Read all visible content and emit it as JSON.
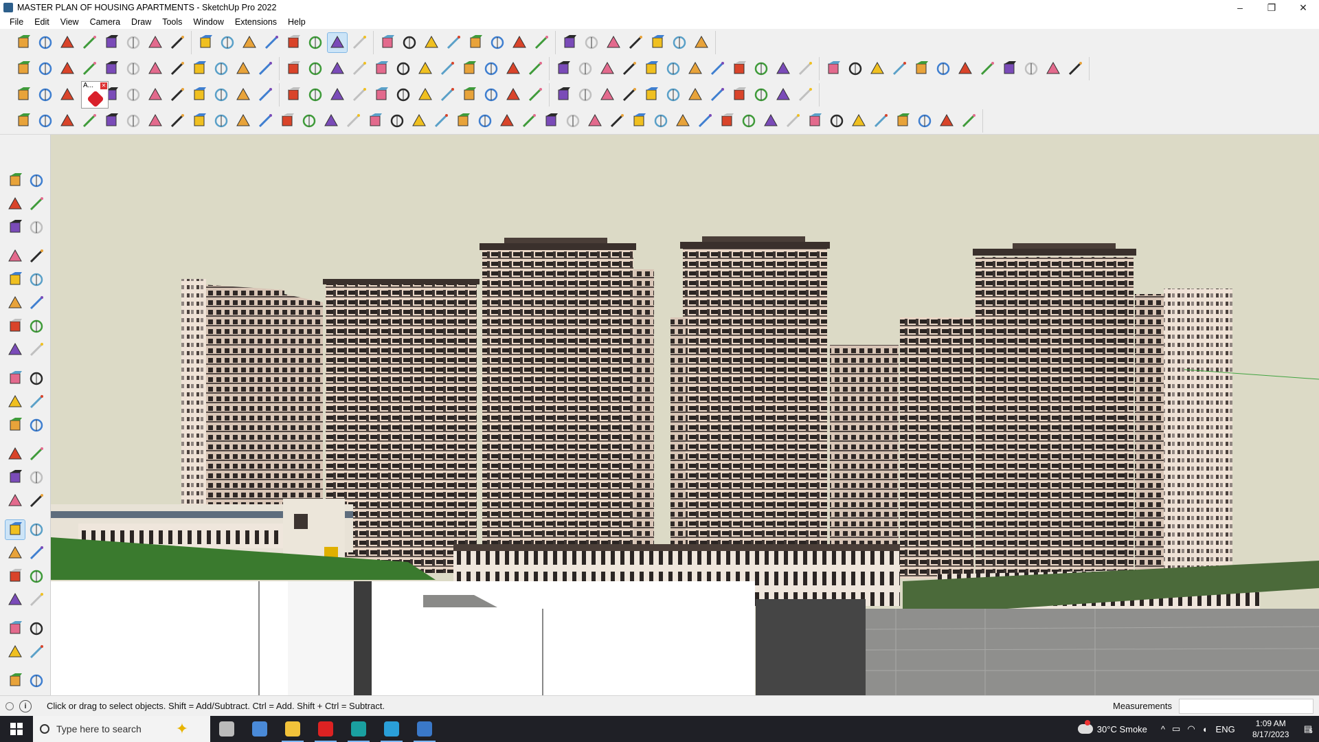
{
  "window": {
    "title": "MASTER PLAN OF HOUSING APARTMENTS - SketchUp Pro 2022",
    "controls": {
      "minimize": "–",
      "restore": "❐",
      "close": "✕"
    }
  },
  "menu": [
    "File",
    "Edit",
    "View",
    "Camera",
    "Draw",
    "Tools",
    "Window",
    "Extensions",
    "Help"
  ],
  "toolbars": {
    "row1_icons": [
      "zoom-icon",
      "select-icon",
      "eraser-icon",
      "pencil-icon",
      "lasso-icon",
      "rectangle-icon",
      "pushpull-icon",
      "followme-icon",
      "move-icon",
      "rotate-icon",
      "scale-icon",
      "tape-icon",
      "text-icon",
      "paint-icon",
      "orbit-icon",
      "pan-icon",
      "zoom-window-icon",
      "zoom-extents-icon",
      "section-icon",
      "layers-icon",
      "styles-icon",
      "user-icon",
      "scenes-icon",
      "components-icon",
      "materials-icon",
      "arrows-icon",
      "measure-icon",
      "outliner-icon",
      "undo-icon",
      "redo-icon",
      "extension-icon"
    ],
    "row2_icons": [
      "box-icon",
      "box-icon",
      "box-icon",
      "pushpull-icon",
      "extrude-icon",
      "extrude-icon",
      "extrude-icon",
      "extrude-icon",
      "extrude-icon",
      "extrude-icon",
      "extrude-icon",
      "curve-icon",
      "face-icon",
      "face-icon",
      "face-icon",
      "terrain-icon",
      "terrain-icon",
      "house-icon",
      "house-icon",
      "house-icon",
      "house-icon",
      "house-icon",
      "house-icon",
      "function-icon",
      "tag-icon",
      "ruler-icon",
      "shape-icon",
      "shape-icon",
      "shape-icon",
      "shape-icon",
      "shape-icon",
      "shape-icon",
      "shape-icon",
      "shape-icon",
      "shape-icon",
      "shape-icon",
      "shape-icon",
      "shape-icon",
      "shape-icon",
      "brush-icon",
      "brush-icon",
      "render-icon",
      "render-icon",
      "render-icon",
      "render-icon",
      "render-icon",
      "render-icon",
      "render-icon"
    ],
    "floating_panel_title": "A...",
    "row3_icons": [
      "plane-icon",
      "plane-icon",
      "plane-icon",
      "plane-icon",
      "plane-icon",
      "rotate-icon",
      "square-icon",
      "grid-icon",
      "window-icon",
      "wood-icon",
      "joint-icon",
      "joint-icon",
      "spline-icon",
      "cross-icon",
      "cross-icon",
      "cross-icon",
      "cone-icon",
      "cone-icon",
      "cone-icon",
      "arc-icon",
      "arc-icon",
      "arc-icon",
      "move-icon",
      "box-icon",
      "undo-icon",
      "cube-icon",
      "cube-icon",
      "cube-icon",
      "cube-icon",
      "grid-icon",
      "grid-icon",
      "grid-icon",
      "grid-icon",
      "explode-icon",
      "circle-icon",
      "grid-icon"
    ],
    "row4_icons": [
      "line-icon",
      "curve-icon",
      "paint-icon",
      "shape-icon",
      "shape-icon",
      "shape-icon",
      "shape-icon",
      "shape-icon",
      "shape-icon",
      "shape-icon",
      "shape-icon",
      "shape-icon",
      "shape-icon",
      "shape-icon",
      "shape-icon",
      "shape-icon",
      "shape-icon",
      "shape-icon",
      "shape-icon",
      "shape-icon",
      "shape-icon",
      "shape-icon",
      "shape-icon",
      "shape-icon",
      "shape-icon",
      "shape-icon",
      "shape-icon",
      "shape-icon",
      "shape-icon",
      "shape-icon",
      "shape-icon",
      "shape-icon",
      "shape-icon",
      "shape-icon",
      "shape-icon",
      "shape-icon",
      "shape-icon",
      "shape-icon",
      "shape-icon",
      "shape-icon",
      "shape-icon",
      "shape-icon",
      "shape-icon",
      "shape-icon"
    ]
  },
  "left_tools": [
    "select-icon",
    "orbit-tool-icon",
    "paint-icon",
    "eraser-icon",
    "components-icon",
    "tape-icon",
    "pencil-icon",
    "freehand-icon",
    "rectangle-icon",
    "rotated-rect-icon",
    "circle-icon",
    "polygon-icon",
    "arc-icon",
    "arc-2pt-icon",
    "pie-icon",
    "arc-3pt-icon",
    "move-icon",
    "pushpull-icon",
    "rotate-icon",
    "followme-icon",
    "scale-icon",
    "offset-icon",
    "tape-measure-icon",
    "dimension-icon",
    "protractor-icon",
    "text-icon",
    "axes-icon",
    "3d-text-icon",
    "orbit-icon",
    "pan-icon",
    "zoom-icon",
    "zoom-window-icon",
    "zoom-extents-icon",
    "previous-view-icon",
    "position-camera-icon",
    "look-around-icon",
    "walk-icon",
    "section-plane-icon",
    "section-display-icon",
    "section-cuts-icon",
    "layers-icon",
    "styles-icon"
  ],
  "status": {
    "hint": "Click or drag to select objects. Shift = Add/Subtract. Ctrl = Add. Shift + Ctrl = Subtract.",
    "measurements_label": "Measurements",
    "measurements_value": ""
  },
  "taskbar": {
    "search_placeholder": "Type here to search",
    "apps": [
      "task-view-icon",
      "calculator-icon",
      "file-explorer-icon",
      "acrobat-icon",
      "3ds-max-icon",
      "edge-icon",
      "sketchup-icon"
    ],
    "weather": "30°C  Smoke",
    "language": "ENG",
    "time": "1:09 AM",
    "date": "8/17/2023",
    "notification_count": "5"
  },
  "colors": {
    "sky": "#dcdac6",
    "building_light": "#e8d4c4",
    "building_dark": "#2a2422",
    "grass": "#3a7a2e",
    "ground_gray": "#8a8a88",
    "active_tool": "#cce4f7"
  }
}
